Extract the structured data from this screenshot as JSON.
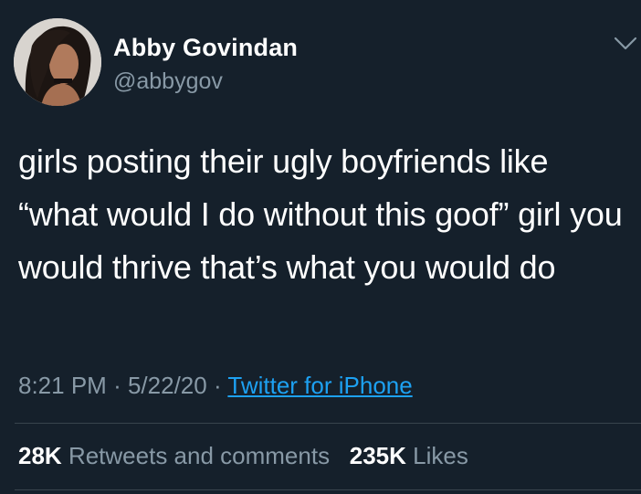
{
  "author": {
    "name": "Abby Govindan",
    "handle": "@abbygov"
  },
  "tweet": {
    "text": "girls posting their ugly boyfriends like “what would I do without this goof” girl you would thrive that’s what you would do",
    "time": "8:21 PM",
    "separator": "·",
    "date": "5/22/20",
    "source": "Twitter for iPhone"
  },
  "stats": {
    "retweets_count": "28K",
    "retweets_label": "Retweets and comments",
    "likes_count": "235K",
    "likes_label": "Likes"
  },
  "icons": {
    "more": "chevron-down-icon"
  },
  "colors": {
    "background": "#15202b",
    "primary_text": "#ffffff",
    "secondary_text": "#8899a6",
    "link": "#1da1f2",
    "divider": "#38444d"
  }
}
